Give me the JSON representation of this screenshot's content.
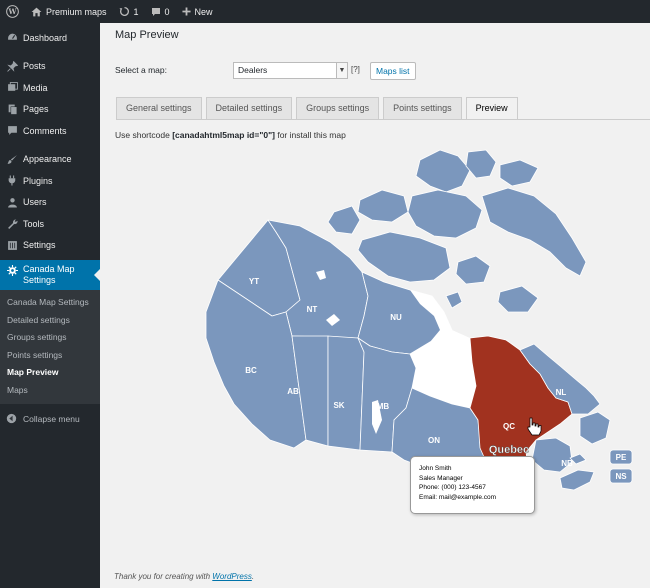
{
  "adminbar": {
    "site_name": "Premium maps",
    "updates_count": "1",
    "comments_count": "0",
    "new_label": "New"
  },
  "sidebar": {
    "items": [
      {
        "label": "Dashboard",
        "icon": "dashboard-icon"
      },
      {
        "label": "Posts",
        "icon": "pin-icon"
      },
      {
        "label": "Media",
        "icon": "media-icon"
      },
      {
        "label": "Pages",
        "icon": "page-icon"
      },
      {
        "label": "Comments",
        "icon": "comment-icon"
      },
      {
        "label": "Appearance",
        "icon": "brush-icon"
      },
      {
        "label": "Plugins",
        "icon": "plug-icon"
      },
      {
        "label": "Users",
        "icon": "user-icon"
      },
      {
        "label": "Tools",
        "icon": "wrench-icon"
      },
      {
        "label": "Settings",
        "icon": "settings-icon"
      }
    ],
    "current": {
      "label_line1": "Canada Map",
      "label_line2": "Settings",
      "icon": "gear-icon"
    },
    "submenu": [
      "Canada Map Settings",
      "Detailed settings",
      "Groups settings",
      "Points settings",
      "Map Preview",
      "Maps"
    ],
    "submenu_current": "Map Preview",
    "collapse_label": "Collapse menu"
  },
  "main": {
    "title": "Map Preview",
    "select_label": "Select a map:",
    "selected_map": "Dealers",
    "help_mark": "[?]",
    "maps_list_button": "Maps list",
    "tabs": [
      "General settings",
      "Detailed settings",
      "Groups settings",
      "Points settings",
      "Preview"
    ],
    "active_tab": "Preview",
    "shortcode_prefix": "Use shortcode",
    "shortcode": "[canadahtml5map id=\"0\"]",
    "shortcode_suffix": "for install this map"
  },
  "map": {
    "regions": {
      "YT": "YT",
      "NT": "NT",
      "NU": "NU",
      "BC": "BC",
      "AB": "AB",
      "SK": "SK",
      "MB": "MB",
      "ON": "ON",
      "QC": "QC",
      "NL": "NL",
      "NB": "NB",
      "PE": "PE",
      "NS": "NS"
    },
    "hovered_region_name": "Quebec",
    "colors": {
      "region": "#7b97bd",
      "highlight": "#a1321f",
      "border": "#ffffff",
      "label_box": "#7b97bd"
    }
  },
  "tooltip": {
    "name": "John Smith",
    "position": "Sales Manager",
    "phone": "Phone: (000) 123-4567",
    "email": "Email: mail@example.com"
  },
  "footer": {
    "text": "Thank you for creating with",
    "link": "WordPress",
    "period": "."
  }
}
